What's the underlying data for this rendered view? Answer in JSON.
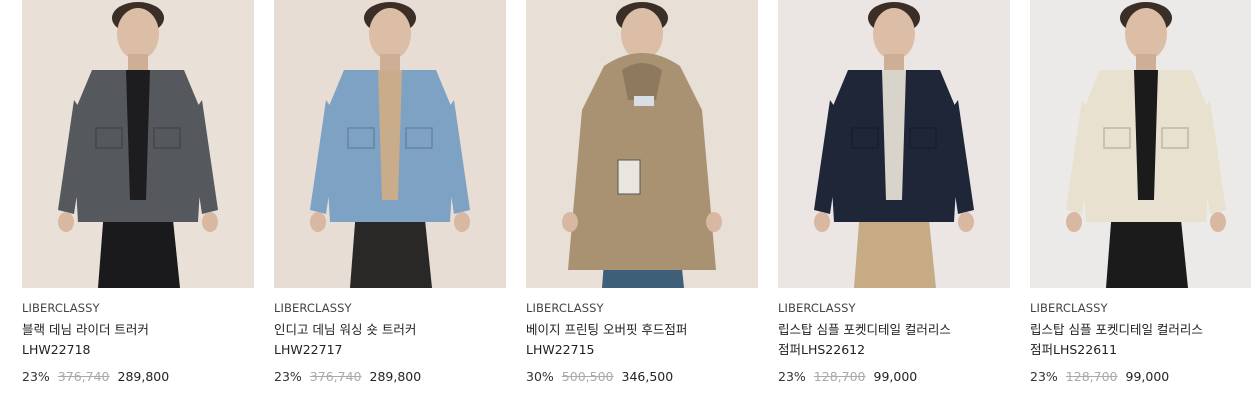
{
  "products": [
    {
      "brand": "LIBERCLASSY",
      "name_line1": "블랙 데님 라이더 트러커",
      "name_line2": "LHW22718",
      "discount": "23%",
      "original_price": "376,740",
      "sale_price": "289,800",
      "photo_icon": "black-denim-rider-jacket-photo",
      "colors": {
        "bg": "#e9e0d8",
        "jacket": "#55585c",
        "inner": "#1d1d1f",
        "pants": "#1a1a1c"
      }
    },
    {
      "brand": "LIBERCLASSY",
      "name_line1": "인디고 데님 워싱 숏 트러커",
      "name_line2": "LHW22717",
      "discount": "23%",
      "original_price": "376,740",
      "sale_price": "289,800",
      "photo_icon": "indigo-denim-trucker-photo",
      "colors": {
        "bg": "#e7ddd4",
        "jacket": "#7ea2c4",
        "inner": "#c9ad8a",
        "pants": "#2a2826"
      }
    },
    {
      "brand": "LIBERCLASSY",
      "name_line1": "베이지 프린팅 오버핏 후드점퍼",
      "name_line2": "LHW22715",
      "discount": "30%",
      "original_price": "500,500",
      "sale_price": "346,500",
      "photo_icon": "beige-hooded-parka-photo",
      "colors": {
        "bg": "#e8dfd7",
        "jacket": "#a89272",
        "inner": "#8d7a5e",
        "pants": "#3d5f78"
      }
    },
    {
      "brand": "LIBERCLASSY",
      "name_line1": "립스탑 심플 포켓디테일 컬러리스",
      "name_line2": "점퍼LHS22612",
      "discount": "23%",
      "original_price": "128,700",
      "sale_price": "99,000",
      "photo_icon": "navy-ripstop-jumper-photo",
      "colors": {
        "bg": "#ebe6e3",
        "jacket": "#1f2638",
        "inner": "#d8d4cc",
        "pants": "#c6ab85"
      }
    },
    {
      "brand": "LIBERCLASSY",
      "name_line1": "립스탑 심플 포켓디테일 컬러리스",
      "name_line2": "점퍼LHS22611",
      "discount": "23%",
      "original_price": "128,700",
      "sale_price": "99,000",
      "photo_icon": "ivory-ripstop-jumper-photo",
      "colors": {
        "bg": "#eceae8",
        "jacket": "#e8e1cf",
        "inner": "#1b1b1b",
        "pants": "#1b1b1b"
      }
    }
  ]
}
